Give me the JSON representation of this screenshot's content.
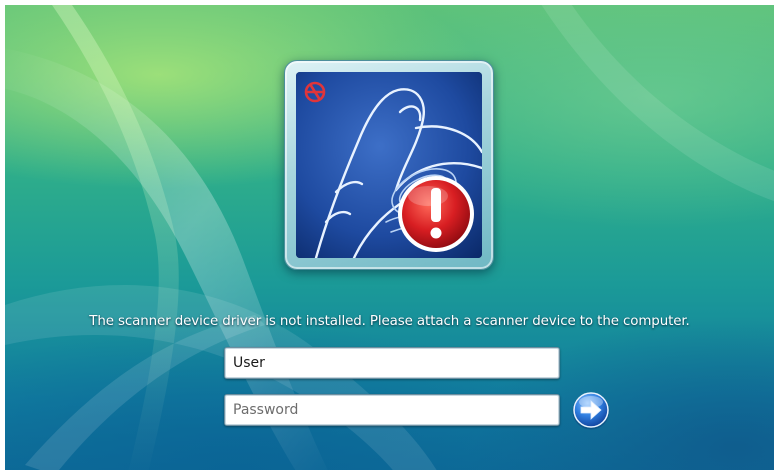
{
  "tile": {
    "icon": "fingerprint-scanner-error-icon",
    "badge_icon": "error-exclamation-icon",
    "logo_icon": "vendor-logo-icon"
  },
  "message": "The scanner device driver is not installed. Please attach a scanner device to the computer.",
  "user_field": {
    "value": "User"
  },
  "password_field": {
    "placeholder": "Password",
    "value": ""
  },
  "submit_button": {
    "icon": "arrow-right-icon"
  },
  "colors": {
    "badge_red": "#c8141e",
    "tile_blue": "#1e4aa0",
    "arrow_blue": "#1a5fc8"
  }
}
